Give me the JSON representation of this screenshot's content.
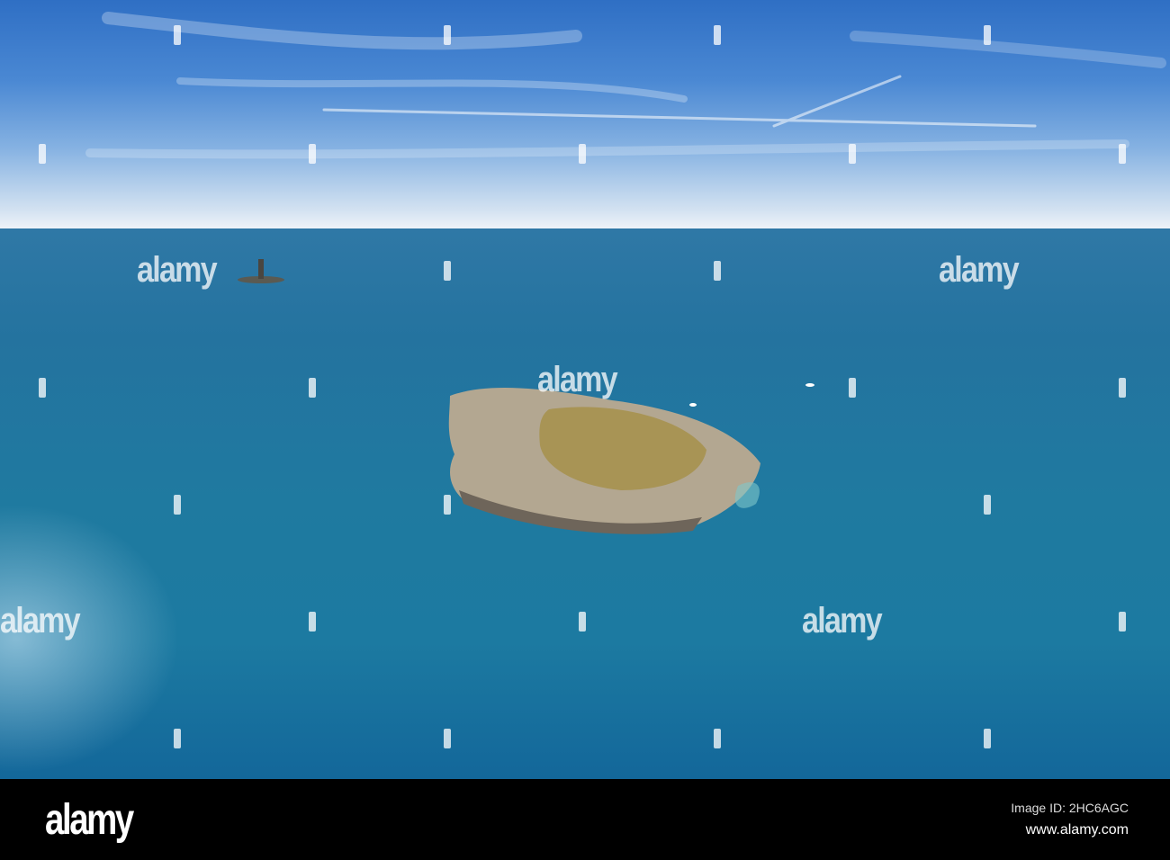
{
  "watermark": "alamy",
  "footer": {
    "logo": "alamy",
    "image_id": "Image ID: 2HC6AGC",
    "url": "www.alamy.com"
  }
}
